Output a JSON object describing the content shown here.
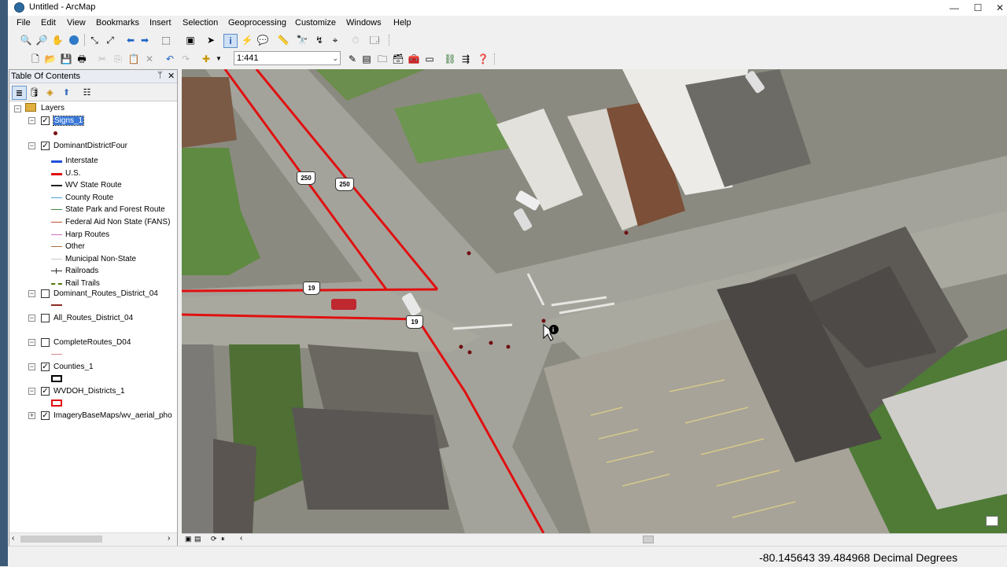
{
  "window": {
    "title": "Untitled - ArcMap",
    "minimize": "—",
    "maximize": "☐",
    "close": "✕"
  },
  "menu": [
    "File",
    "Edit",
    "View",
    "Bookmarks",
    "Insert",
    "Selection",
    "Geoprocessing",
    "Customize",
    "Windows",
    "Help"
  ],
  "toolbar": {
    "scale": "1:441"
  },
  "toc": {
    "title": "Table Of Contents",
    "pin": "ᛘ",
    "close": "✕",
    "root": "Layers",
    "layers": [
      {
        "name": "Signs_1",
        "checked": true,
        "selected": true
      },
      {
        "name": "DominantDistrictFour",
        "checked": true
      },
      {
        "name": "Dominant_Routes_District_04",
        "checked": false
      },
      {
        "name": "All_Routes_District_04",
        "checked": false
      },
      {
        "name": "CompleteRoutes_D04",
        "checked": false
      },
      {
        "name": "Counties_1",
        "checked": true
      },
      {
        "name": "WVDOH_Districts_1",
        "checked": true
      },
      {
        "name": "ImageryBaseMaps/wv_aerial_pho",
        "checked": true
      }
    ],
    "legend": [
      {
        "label": "Interstate",
        "color": "#1f4fd6",
        "style": "solid",
        "width": 3
      },
      {
        "label": "U.S.",
        "color": "#e01010",
        "style": "solid",
        "width": 3
      },
      {
        "label": "WV State Route",
        "color": "#222222",
        "style": "solid",
        "width": 2
      },
      {
        "label": "County Route",
        "color": "#4ea0d8",
        "style": "solid",
        "width": 1
      },
      {
        "label": "State Park and  Forest Route",
        "color": "#3a8a3a",
        "style": "solid",
        "width": 1
      },
      {
        "label": "Federal Aid Non State (FANS)",
        "color": "#c05030",
        "style": "solid",
        "width": 1
      },
      {
        "label": "Harp Routes",
        "color": "#d070c0",
        "style": "solid",
        "width": 1
      },
      {
        "label": "Other",
        "color": "#b07040",
        "style": "solid",
        "width": 1
      },
      {
        "label": "Municipal Non-State",
        "color": "#c8c8c8",
        "style": "solid",
        "width": 1
      },
      {
        "label": "Railroads",
        "color": "#333333",
        "style": "rail",
        "width": 1
      },
      {
        "label": "Rail Trails",
        "color": "#5a7a10",
        "style": "dash",
        "width": 2
      }
    ]
  },
  "map": {
    "route_shields": [
      "250",
      "250",
      "19",
      "19"
    ]
  },
  "status": {
    "coordinates": "-80.145643  39.484968 Decimal Degrees"
  }
}
